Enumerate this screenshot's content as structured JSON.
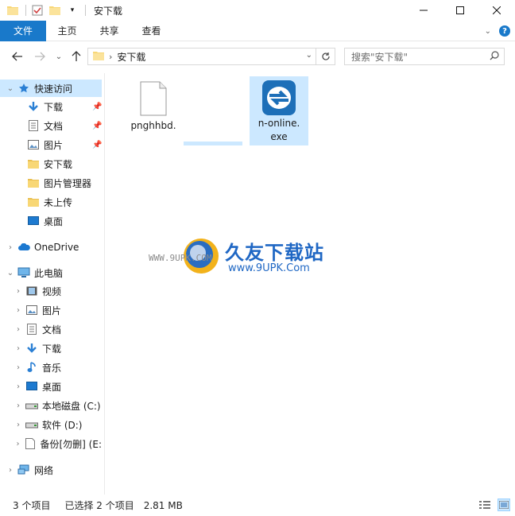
{
  "window": {
    "title": "安下载"
  },
  "ribbon": {
    "tabs": [
      "文件",
      "主页",
      "共享",
      "查看"
    ]
  },
  "address": {
    "path": "安下载",
    "search_placeholder": "搜索\"安下载\""
  },
  "nav": {
    "quick_access": "快速访问",
    "quick_items": [
      {
        "label": "下载",
        "icon": "download-icon",
        "pinned": true
      },
      {
        "label": "文档",
        "icon": "document-icon",
        "pinned": true
      },
      {
        "label": "图片",
        "icon": "picture-icon",
        "pinned": true
      },
      {
        "label": "安下载",
        "icon": "folder-icon",
        "pinned": false
      },
      {
        "label": "图片管理器",
        "icon": "folder-icon",
        "pinned": false
      },
      {
        "label": "未上传",
        "icon": "folder-icon",
        "pinned": false
      },
      {
        "label": "桌面",
        "icon": "desktop-icon",
        "pinned": false
      }
    ],
    "onedrive": "OneDrive",
    "this_pc": "此电脑",
    "pc_items": [
      {
        "label": "视频",
        "icon": "video-icon"
      },
      {
        "label": "图片",
        "icon": "picture-icon"
      },
      {
        "label": "文档",
        "icon": "document-icon"
      },
      {
        "label": "下载",
        "icon": "download-icon"
      },
      {
        "label": "音乐",
        "icon": "music-icon"
      },
      {
        "label": "桌面",
        "icon": "desktop-icon"
      },
      {
        "label": "本地磁盘 (C:)",
        "icon": "drive-icon"
      },
      {
        "label": "软件 (D:)",
        "icon": "drive-icon"
      },
      {
        "label": "备份[勿删] (E:",
        "icon": "blank-file-icon"
      }
    ],
    "network": "网络"
  },
  "files": [
    {
      "label": "pnghhbd.",
      "icon": "blank-file-icon",
      "selected": false
    },
    {
      "label": "n-online.\nexe",
      "icon": "app-exe-icon",
      "selected": true
    }
  ],
  "watermark": {
    "title": "久友下载站",
    "url": "www.9UPK.Com",
    "www": "WWW.9UPK.COM"
  },
  "status": {
    "count": "3 个项目",
    "selected": "已选择 2 个项目",
    "size": "2.81 MB"
  },
  "colors": {
    "accent": "#1979ca",
    "selection": "#cce8ff",
    "folder": "#f8d775"
  }
}
